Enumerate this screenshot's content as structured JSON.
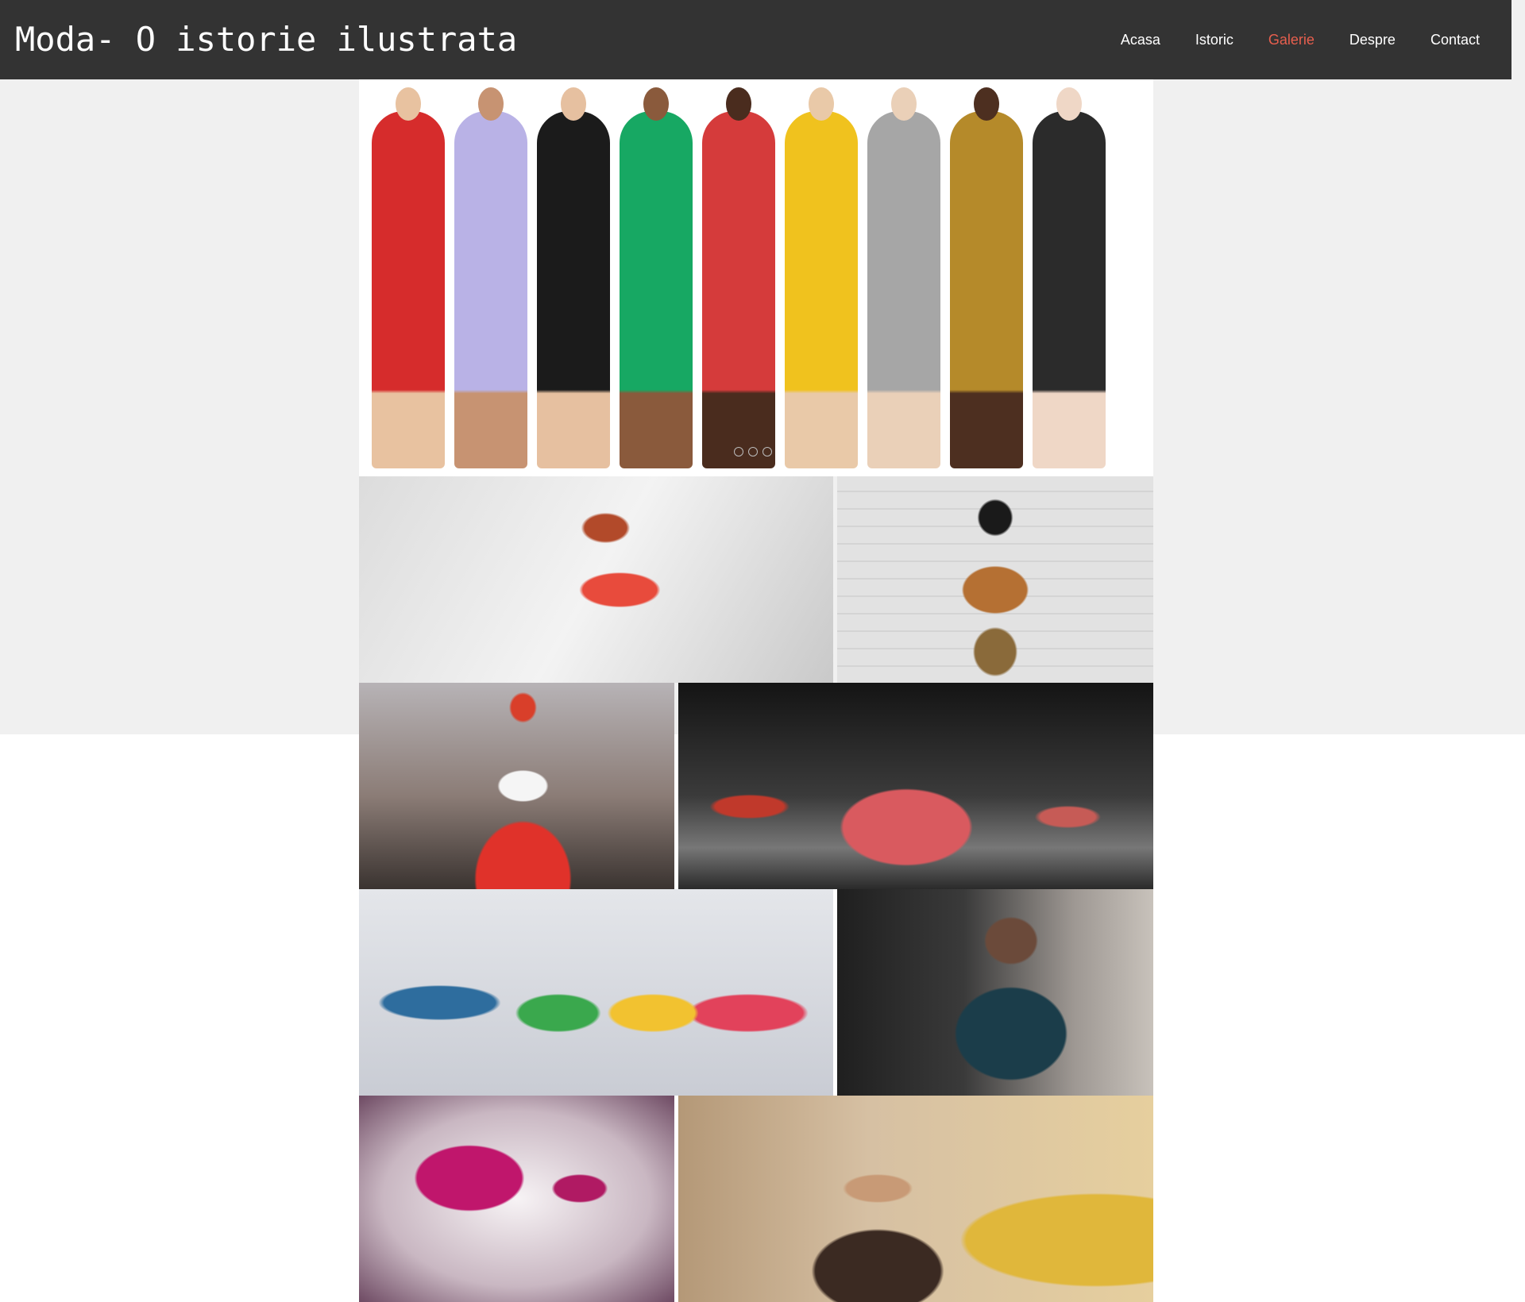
{
  "header": {
    "title": "Moda- O istorie ilustrata",
    "nav": [
      {
        "label": "Acasa",
        "active": false
      },
      {
        "label": "Istoric",
        "active": false
      },
      {
        "label": "Galerie",
        "active": true
      },
      {
        "label": "Despre",
        "active": false
      },
      {
        "label": "Contact",
        "active": false
      }
    ]
  },
  "colors": {
    "header_bg": "#333333",
    "active_link": "#e85f4e",
    "page_band": "#f0f0f0",
    "page_bg": "#ffffff"
  },
  "hero": {
    "slide_count": 3,
    "models": [
      {
        "outfit": "#d62c2c",
        "skin": "#e8c2a0"
      },
      {
        "outfit": "#b9b2e6",
        "skin": "#c79372"
      },
      {
        "outfit": "#1b1b1b",
        "skin": "#e6c0a0"
      },
      {
        "outfit": "#17a863",
        "skin": "#8a5a3c"
      },
      {
        "outfit": "#d53b3b",
        "skin": "#4a2c1e"
      },
      {
        "outfit": "#f0c21e",
        "skin": "#e9c9a8"
      },
      {
        "outfit": "#a6a6a6",
        "skin": "#ead0b8"
      },
      {
        "outfit": "#b58a2a",
        "skin": "#4d2f20"
      },
      {
        "outfit": "#2b2b2b",
        "skin": "#efd7c6"
      }
    ]
  },
  "gallery": {
    "photos": [
      "p1",
      "p2",
      "p3",
      "p4",
      "p5",
      "p6",
      "p7",
      "p8"
    ]
  }
}
